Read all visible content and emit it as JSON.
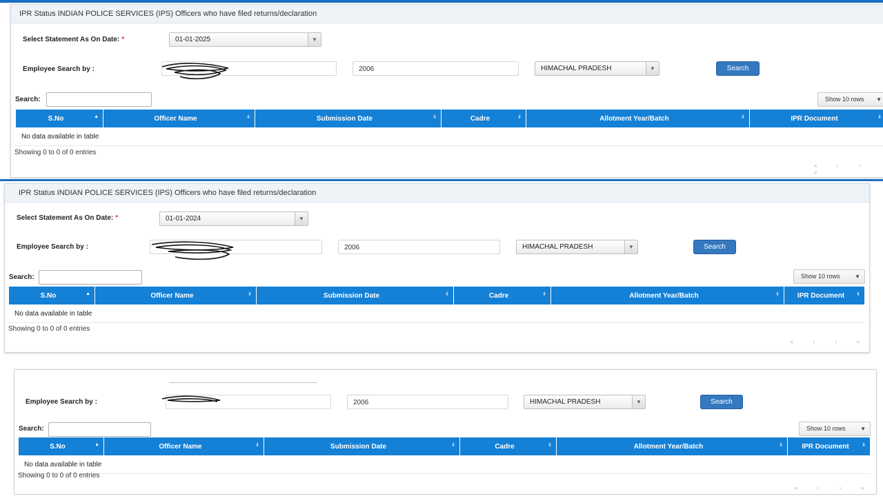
{
  "title": "IPR Status INDIAN POLICE SERVICES (IPS) Officers who have filed returns/declaration",
  "labels": {
    "statement_date": "Select Statement As On Date:",
    "required_mark": "*",
    "employee_search": "Employee Search by :",
    "search": "Search:",
    "search_button": "Search",
    "show_rows": "Show 10 rows",
    "no_data": "No data available in table",
    "showing": "Showing 0 to 0 of 0 entries"
  },
  "columns": [
    "S.No",
    "Officer Name",
    "Submission Date",
    "Cadre",
    "Allotment Year/Batch",
    "IPR Document"
  ],
  "panels": [
    {
      "date": "01-01-2025",
      "batch": "2006",
      "cadre": "HIMACHAL PRADESH"
    },
    {
      "date": "01-01-2024",
      "batch": "2006",
      "cadre": "HIMACHAL PRADESH"
    },
    {
      "batch": "2006",
      "cadre": "HIMACHAL PRADESH"
    }
  ],
  "icons": {
    "sort_asc": "▲",
    "sort_both": "⬍",
    "dropdown": "▼",
    "pager": [
      "«",
      "‹",
      "›",
      "»"
    ]
  },
  "colors": {
    "header": "#1480d6",
    "button": "#3479c0",
    "top_bar": "#1a6fc4"
  }
}
